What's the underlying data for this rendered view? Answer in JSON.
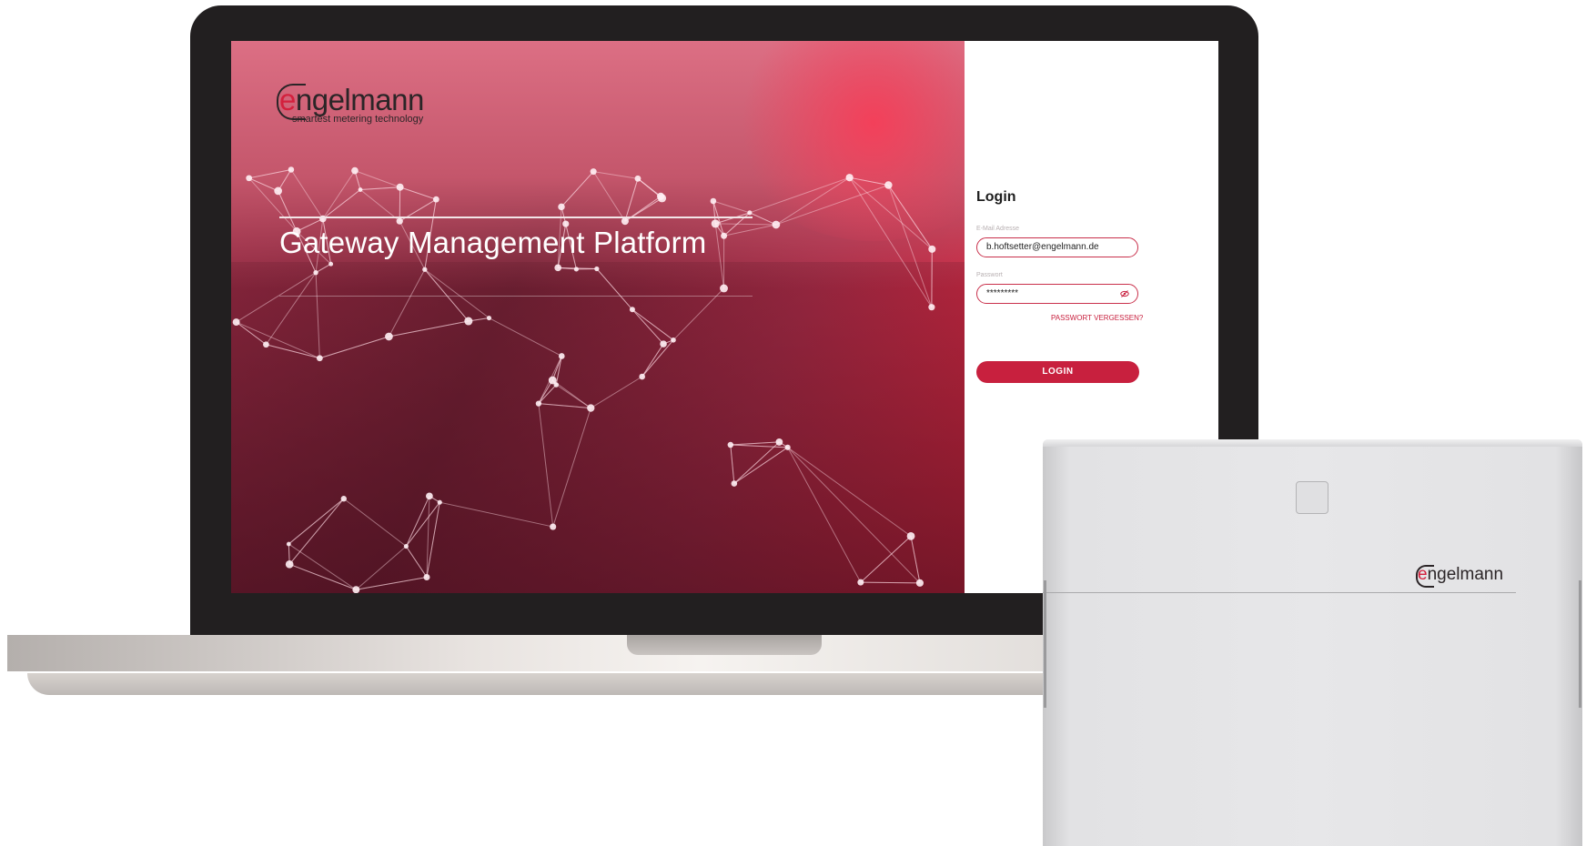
{
  "brand": {
    "name_prefix": "",
    "name_e": "e",
    "name_rest": "ngelmann",
    "tagline": "smartest metering technology"
  },
  "hero": {
    "title": "Gateway Management Platform"
  },
  "login": {
    "title": "Login",
    "email_label": "E-Mail Adresse",
    "email_value": "b.hoftsetter@engelmann.de",
    "password_label": "Passwort",
    "password_value": "*********",
    "forgot_link": "PASSWORT VERGESSEN?",
    "submit_label": "LOGIN"
  },
  "device": {
    "logo_e": "e",
    "logo_rest": "ngelmann"
  },
  "icons": {
    "password_toggle": "eye-slash-icon"
  },
  "colors": {
    "brand_red": "#c8203e",
    "laptop_bezel": "#221f20",
    "device_body": "#e5e5e7"
  }
}
